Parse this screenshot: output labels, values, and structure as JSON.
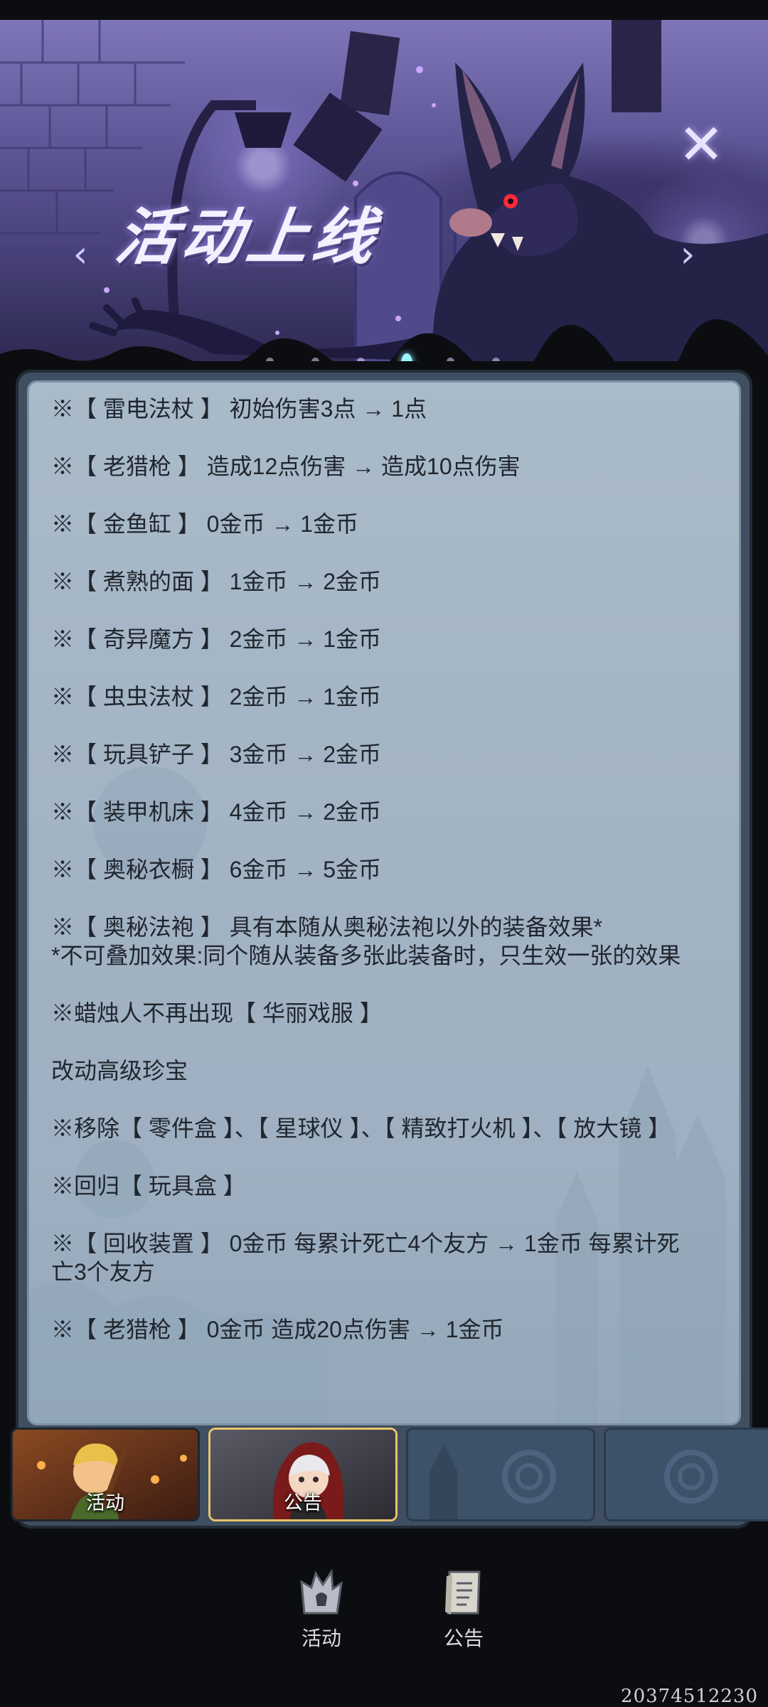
{
  "banner": {
    "title": "活动上线",
    "close": "✕",
    "prev": "‹",
    "next": "›"
  },
  "announcement": {
    "lines": [
      "※【 雷电法杖 】 初始伤害3点 → 1点",
      "※【 老猎枪 】 造成12点伤害 → 造成10点伤害",
      "※【 金鱼缸 】 0金币 → 1金币",
      "※【 煮熟的面 】 1金币 → 2金币",
      "※【 奇异魔方 】 2金币 → 1金币",
      "※【 虫虫法杖 】 2金币 → 1金币",
      "※【 玩具铲子 】 3金币 → 2金币",
      "※【 装甲机床 】 4金币 → 2金币",
      "※【 奥秘衣橱 】 6金币 → 5金币",
      "※【 奥秘法袍 】 具有本随从奥秘法袍以外的装备效果*\n*不可叠加效果:同个随从装备多张此装备时，只生效一张的效果",
      "※蜡烛人不再出现【 华丽戏服 】",
      "改动高级珍宝",
      "※移除【 零件盒 】、【 星球仪 】、【 精致打火机 】、【 放大镜 】",
      "※回归【 玩具盒 】",
      "※【 回收装置 】 0金币 每累计死亡4个友方 → 1金币 每累计死亡3个友方",
      "※【 老猎枪 】 0金币 造成20点伤害 → 1金币"
    ]
  },
  "tabs": [
    {
      "label": "活动"
    },
    {
      "label": "公告"
    }
  ],
  "bottom_nav": [
    {
      "label": "活动",
      "icon": "bell-tower-icon"
    },
    {
      "label": "公告",
      "icon": "notice-scroll-icon"
    }
  ],
  "player_id": "20374512230"
}
